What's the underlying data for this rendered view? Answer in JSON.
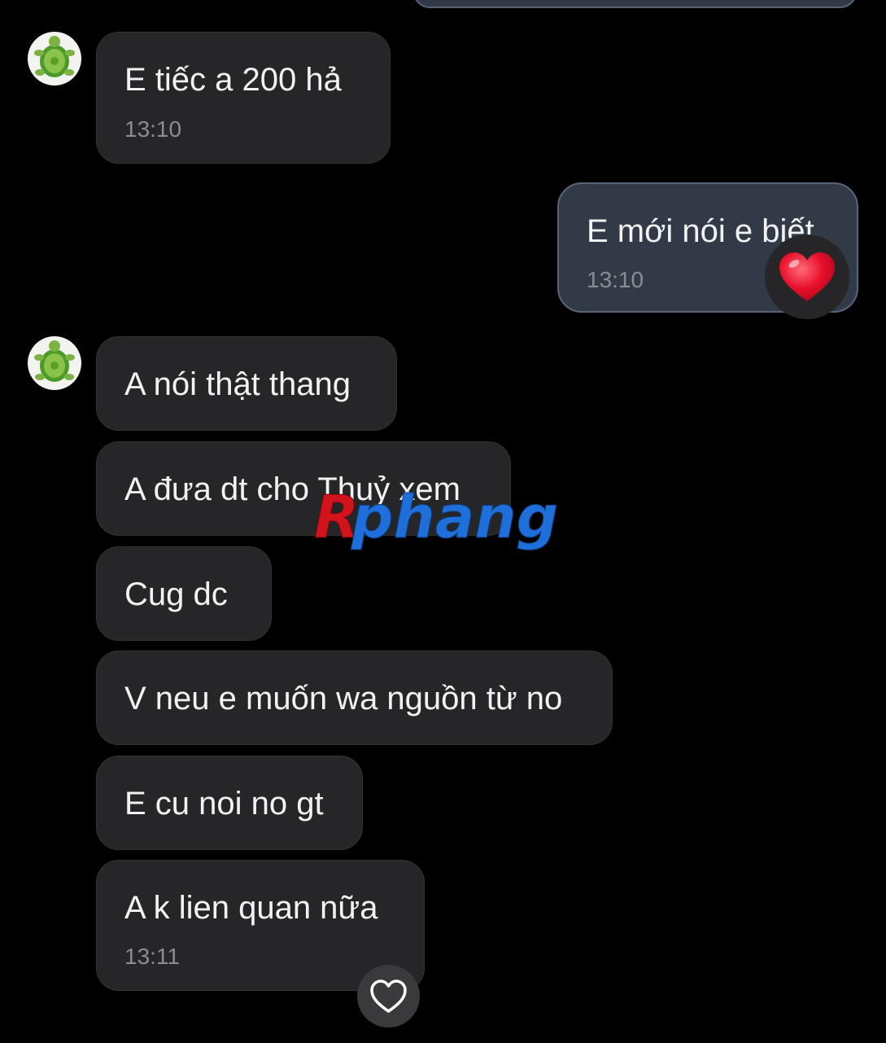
{
  "conversation": {
    "messages": [
      {
        "direction": "incoming",
        "text": "E tiếc a 200 hả",
        "time": "13:10"
      },
      {
        "direction": "outgoing",
        "text": "E mới nói e biết",
        "time": "13:10",
        "reaction": "heart"
      },
      {
        "direction": "incoming",
        "text": "A nói thật thang",
        "time": ""
      },
      {
        "direction": "incoming",
        "text": "A đưa dt cho Thuỷ xem",
        "time": ""
      },
      {
        "direction": "incoming",
        "text": "Cug dc",
        "time": ""
      },
      {
        "direction": "incoming",
        "text": "V neu e muốn wa nguồn từ no",
        "time": ""
      },
      {
        "direction": "incoming",
        "text": "E cu noi no gt",
        "time": ""
      },
      {
        "direction": "incoming",
        "text": "A k lien quan nữa",
        "time": "13:11"
      }
    ]
  },
  "watermark": {
    "text": "Rphang",
    "colors": {
      "r": "#d2131c",
      "rest": "#1e6fd9"
    }
  },
  "theme": {
    "background": "#000000",
    "incoming_bubble": "#262628",
    "outgoing_bubble": "#333a47",
    "outgoing_border": "#59637a",
    "reaction_heart_color": "#e8102b"
  },
  "icons": {
    "avatar": "turtle-avatar-icon",
    "reaction": "red-heart-icon",
    "react_button": "heart-outline-icon"
  }
}
